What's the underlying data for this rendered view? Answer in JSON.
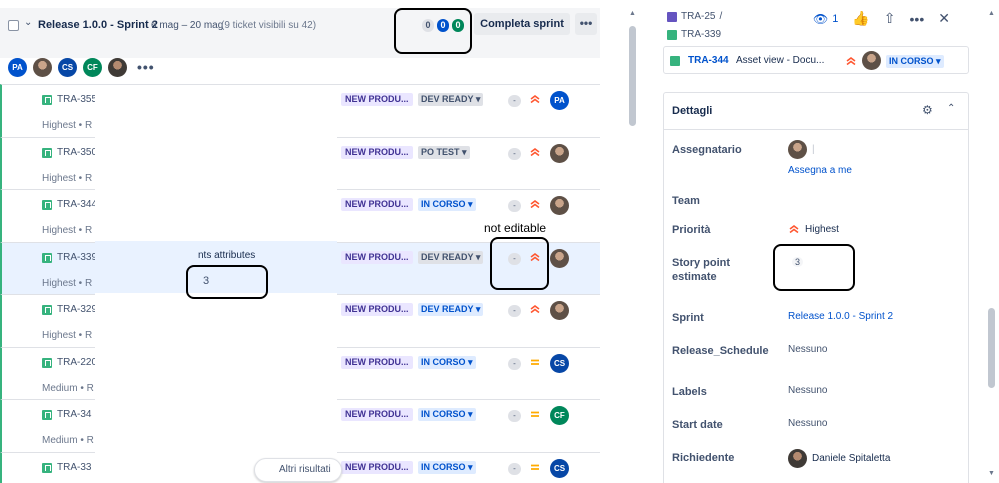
{
  "sprint": {
    "title": "Release 1.0.0 - Sprint 2",
    "dates": "6 mag – 20 mag",
    "count": "(9 ticket visibili su 42)",
    "badge_todo": "0",
    "badge_inprogress": "0",
    "badge_done": "0",
    "complete_label": "Completa sprint",
    "more_label": "•••"
  },
  "avatars": [
    "PA",
    "CS",
    "CF"
  ],
  "avatars_more": "•••",
  "rows": [
    {
      "key": "TRA-355",
      "summary": "",
      "prio": "Highest • R",
      "epic": "NEW PRODU...",
      "status": "DEV READY ▾",
      "sp": "-",
      "avatar": "PA"
    },
    {
      "key": "TRA-350",
      "summary": "",
      "prio": "Highest • R",
      "epic": "NEW PRODU...",
      "status": "PO TEST ▾",
      "sp": "-",
      "avatar": ""
    },
    {
      "key": "TRA-344",
      "summary": "",
      "prio": "Highest • R",
      "epic": "NEW PRODU...",
      "status": "IN CORSO ▾",
      "sp": "-",
      "avatar": ""
    },
    {
      "key": "TRA-339",
      "summary": "nts attributes",
      "prio": "Highest • R",
      "epic": "NEW PRODU...",
      "status": "DEV READY ▾",
      "sp": "-",
      "avatar": ""
    },
    {
      "key": "TRA-329",
      "summary": "",
      "prio": "Highest • R",
      "epic": "NEW PRODU...",
      "status": "DEV READY ▾",
      "sp": "-",
      "avatar": ""
    },
    {
      "key": "TRA-220",
      "summary": "",
      "prio": "Medium • R",
      "epic": "NEW PRODU...",
      "status": "IN CORSO ▾",
      "sp": "-",
      "avatar": "CS"
    },
    {
      "key": "TRA-34",
      "summary": "",
      "prio": "Medium • R",
      "epic": "NEW PRODU...",
      "status": "IN CORSO ▾",
      "sp": "-",
      "avatar": "CF"
    },
    {
      "key": "TRA-33",
      "summary": "",
      "prio": "",
      "epic": "NEW PRODU...",
      "status": "IN CORSO ▾",
      "sp": "-",
      "avatar": "CS"
    }
  ],
  "annotation": {
    "not_editable": "not editable",
    "story_point_value": "3"
  },
  "more_results": "Altri risultati",
  "detail": {
    "breadcrumb_parent": "TRA-25",
    "breadcrumb_sep": "/",
    "breadcrumb_current": "TRA-339",
    "watch_count": "1",
    "child": {
      "key": "TRA-344",
      "summary": "Asset view - Docu...",
      "status": "IN CORSO ▾"
    },
    "section_title": "Dettagli",
    "fields": {
      "assignee_label": "Assegnatario",
      "assignee_value": "|",
      "assign_me": "Assegna a me",
      "team_label": "Team",
      "priority_label": "Priorità",
      "priority_value": "Highest",
      "sp_label": "Story point estimate",
      "sp_value": "3",
      "sprint_label": "Sprint",
      "sprint_value": "Release 1.0.0 - Sprint 2",
      "release_label": "Release_Schedule",
      "release_value": "Nessuno",
      "labels_label": "Labels",
      "labels_value": "Nessuno",
      "start_label": "Start date",
      "start_value": "Nessuno",
      "reporter_label": "Richiedente",
      "reporter_value": "Daniele Spitaletta"
    }
  },
  "colors": {
    "accent": "#0052cc",
    "story": "#36b37e",
    "highest": "#ff5630",
    "medium": "#ffab00"
  }
}
